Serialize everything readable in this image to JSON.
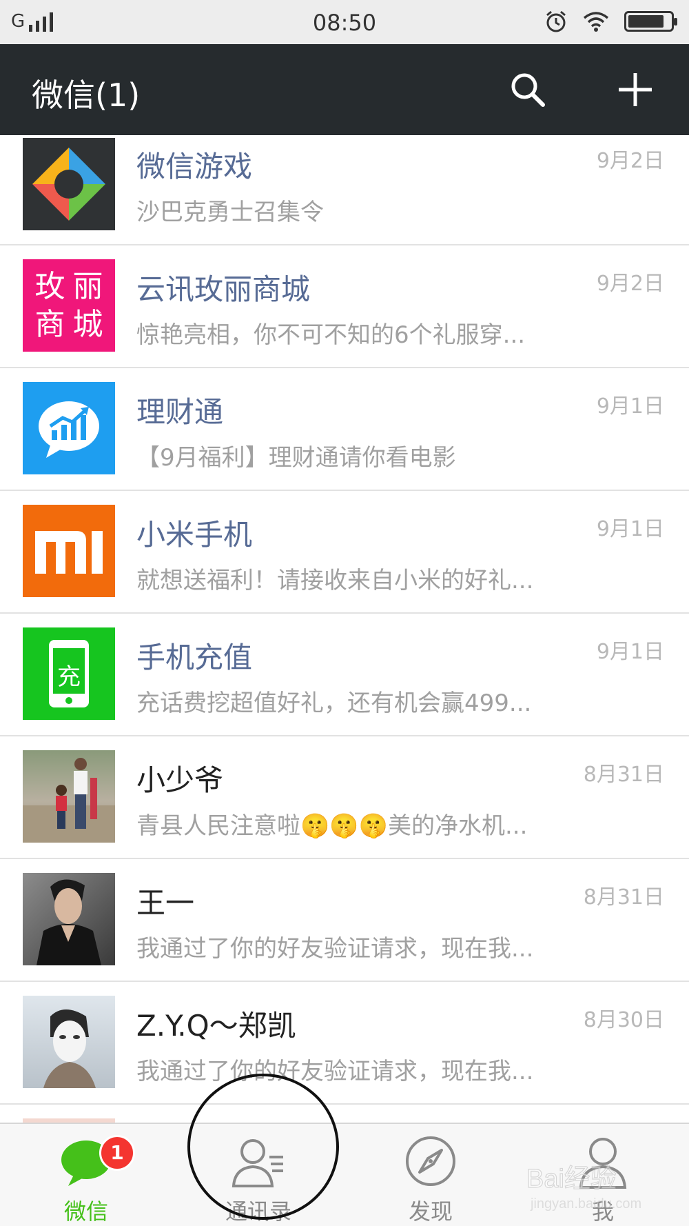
{
  "status_bar": {
    "network": "G",
    "time": "08:50",
    "battery_level": 0.85
  },
  "header": {
    "title": "微信(1)",
    "search_icon": "search-icon",
    "add_icon": "plus-icon"
  },
  "chats": [
    {
      "name": "微信游戏",
      "message": "沙巴克勇士召集令",
      "time": "9月2日",
      "avatar_icon": "wechat-games-logo"
    },
    {
      "name": "云讯玫丽商城",
      "message": "惊艳亮相，你不可不知的6个礼服穿...",
      "time": "9月2日",
      "avatar_text": [
        "玫",
        "丽",
        "商",
        "城"
      ]
    },
    {
      "name": "理财通",
      "message": "【9月福利】理财通请你看电影",
      "time": "9月1日",
      "avatar_icon": "chart-bubble-icon"
    },
    {
      "name": "小米手机",
      "message": "就想送福利！请接收来自小米的好礼...",
      "time": "9月1日",
      "avatar_icon": "mi-logo"
    },
    {
      "name": "手机充值",
      "message": "充话费挖超值好礼，还有机会赢499...",
      "time": "9月1日",
      "avatar_text": [
        "充"
      ]
    },
    {
      "name": "小少爷",
      "message": "青县人民注意啦🤫🤫🤫美的净水机...",
      "time": "8月31日",
      "avatar_icon": "photo-family"
    },
    {
      "name": "王一",
      "message": "我通过了你的好友验证请求，现在我...",
      "time": "8月31日",
      "avatar_icon": "photo-man"
    },
    {
      "name": "Z.Y.Q～郑凯",
      "message": "我通过了你的好友验证请求，现在我...",
      "time": "8月30日",
      "avatar_icon": "photo-mask"
    }
  ],
  "tabs": [
    {
      "label": "微信",
      "icon": "chat-bubble-icon",
      "badge": "1",
      "active": true
    },
    {
      "label": "通讯录",
      "icon": "contacts-icon",
      "active": false
    },
    {
      "label": "发现",
      "icon": "compass-icon",
      "active": false
    },
    {
      "label": "我",
      "icon": "person-icon",
      "active": false
    }
  ],
  "watermark": {
    "text": "Bai经验",
    "url": "jingyan.baidu.com"
  },
  "colors": {
    "header_bg": "#262b2e",
    "accent_green": "#45c01a",
    "badge_red": "#f43530",
    "name_blue": "#576b95"
  }
}
